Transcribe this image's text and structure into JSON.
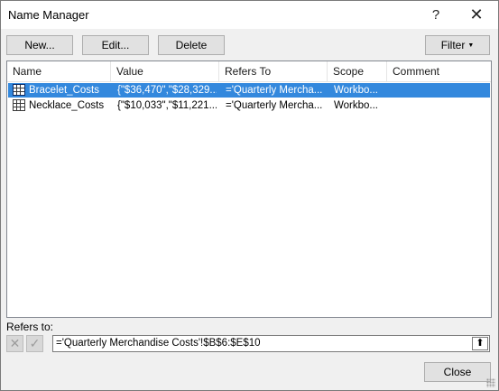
{
  "window": {
    "title": "Name Manager",
    "help": "?",
    "close": "✕"
  },
  "toolbar": {
    "new_label": "New...",
    "edit_label": "Edit...",
    "delete_label": "Delete",
    "filter_label": "Filter"
  },
  "table": {
    "columns": [
      "Name",
      "Value",
      "Refers To",
      "Scope",
      "Comment"
    ],
    "rows": [
      {
        "name": "Bracelet_Costs",
        "value": "{\"$36,470\",\"$28,329...",
        "refers_to": "='Quarterly Mercha...",
        "scope": "Workbo...",
        "comment": "",
        "selected": true
      },
      {
        "name": "Necklace_Costs",
        "value": "{\"$10,033\",\"$11,221...",
        "refers_to": "='Quarterly Mercha...",
        "scope": "Workbo...",
        "comment": "",
        "selected": false
      }
    ]
  },
  "refers": {
    "label": "Refers to:",
    "value": "='Quarterly Merchandise Costs'!$B$6:$E$10"
  },
  "footer": {
    "close_label": "Close"
  },
  "colors": {
    "selection": "#3388dd",
    "dialog_bg": "#f0f0f0"
  },
  "icons": {
    "row_icon": "table-grid-icon",
    "cancel": "x-icon",
    "confirm": "check-icon",
    "collapse": "collapse-dialog-icon"
  }
}
